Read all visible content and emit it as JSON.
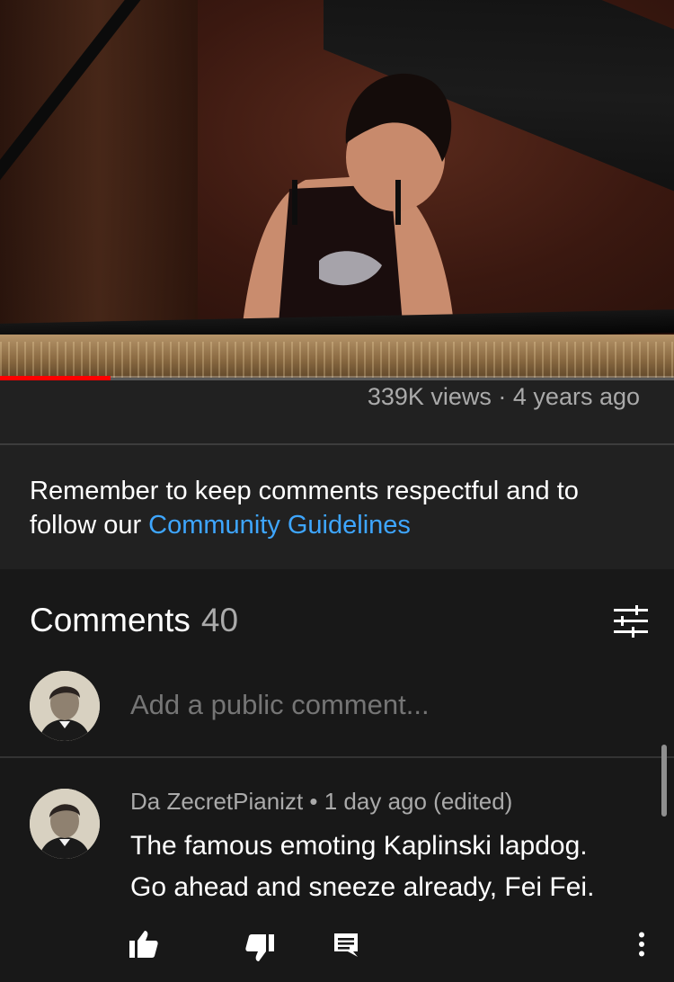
{
  "video": {
    "views": "339K views",
    "age": "4 years ago",
    "progress": 0.164
  },
  "guidelines": {
    "text": "Remember to keep comments respectful and to follow our ",
    "link": "Community Guidelines"
  },
  "comments": {
    "title": "Comments",
    "count": "40",
    "add_placeholder": "Add a public comment...",
    "items": [
      {
        "author": "Da ZecretPianizt",
        "time": "1 day ago (edited)",
        "text_line1": "The famous emoting Kaplinski lapdog.",
        "text_line2": "Go ahead and sneeze already, Fei Fei."
      }
    ]
  },
  "icons": {
    "sort": "tune-icon",
    "like": "thumb-up-icon",
    "dislike": "thumb-down-icon",
    "reply": "reply-comment-icon",
    "more": "more-vertical-icon"
  },
  "colors": {
    "link": "#3ea6ff",
    "progress": "#ff0000",
    "secondary_text": "#aaaaaa"
  }
}
